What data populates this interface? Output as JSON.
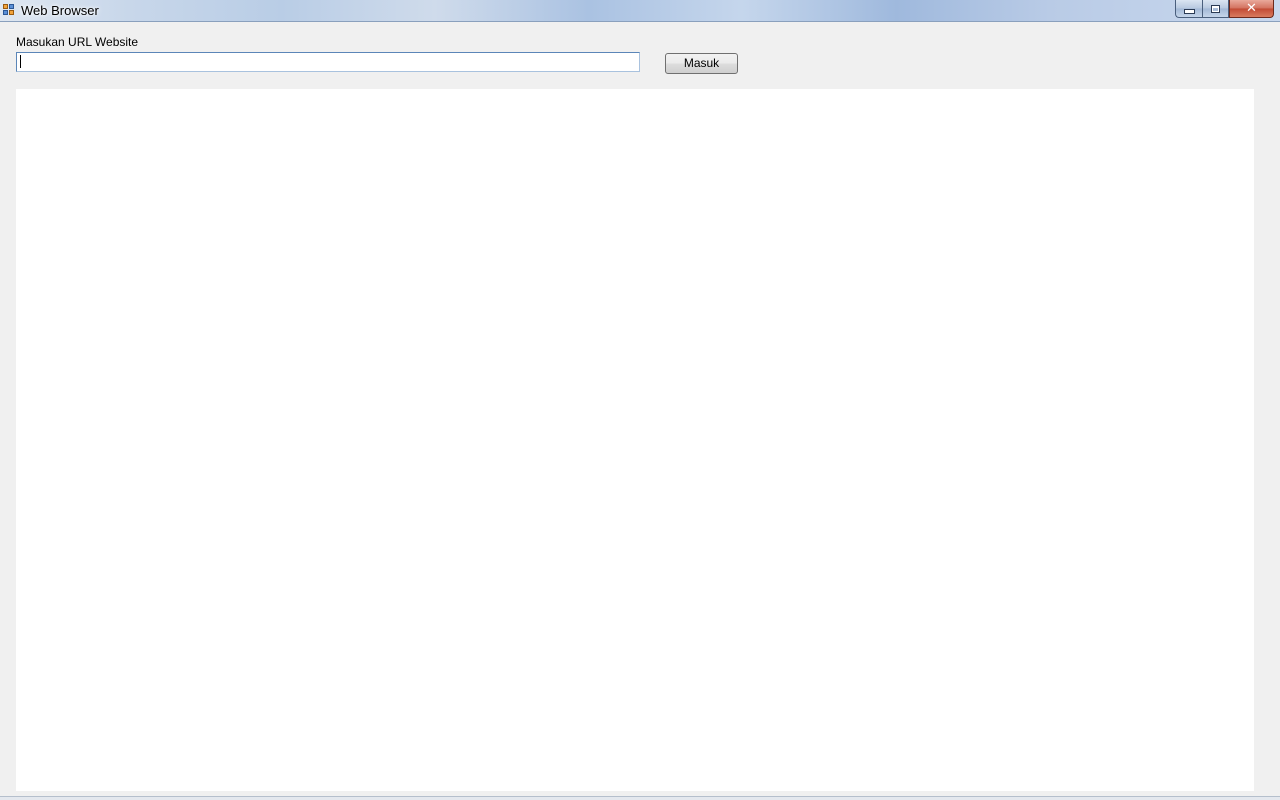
{
  "window": {
    "title": "Web Browser",
    "controls": {
      "close_glyph": "✕"
    },
    "icons": {
      "app": "application-icon",
      "minimize": "minimize-icon",
      "maximize": "maximize-icon",
      "close": "close-icon"
    }
  },
  "form": {
    "url_label": "Masukan URL Website",
    "url_value": "",
    "submit_label": "Masuk"
  },
  "colors": {
    "background": "#f0f0f0",
    "browser_view": "#ffffff",
    "input_border": "#5b86b8"
  }
}
